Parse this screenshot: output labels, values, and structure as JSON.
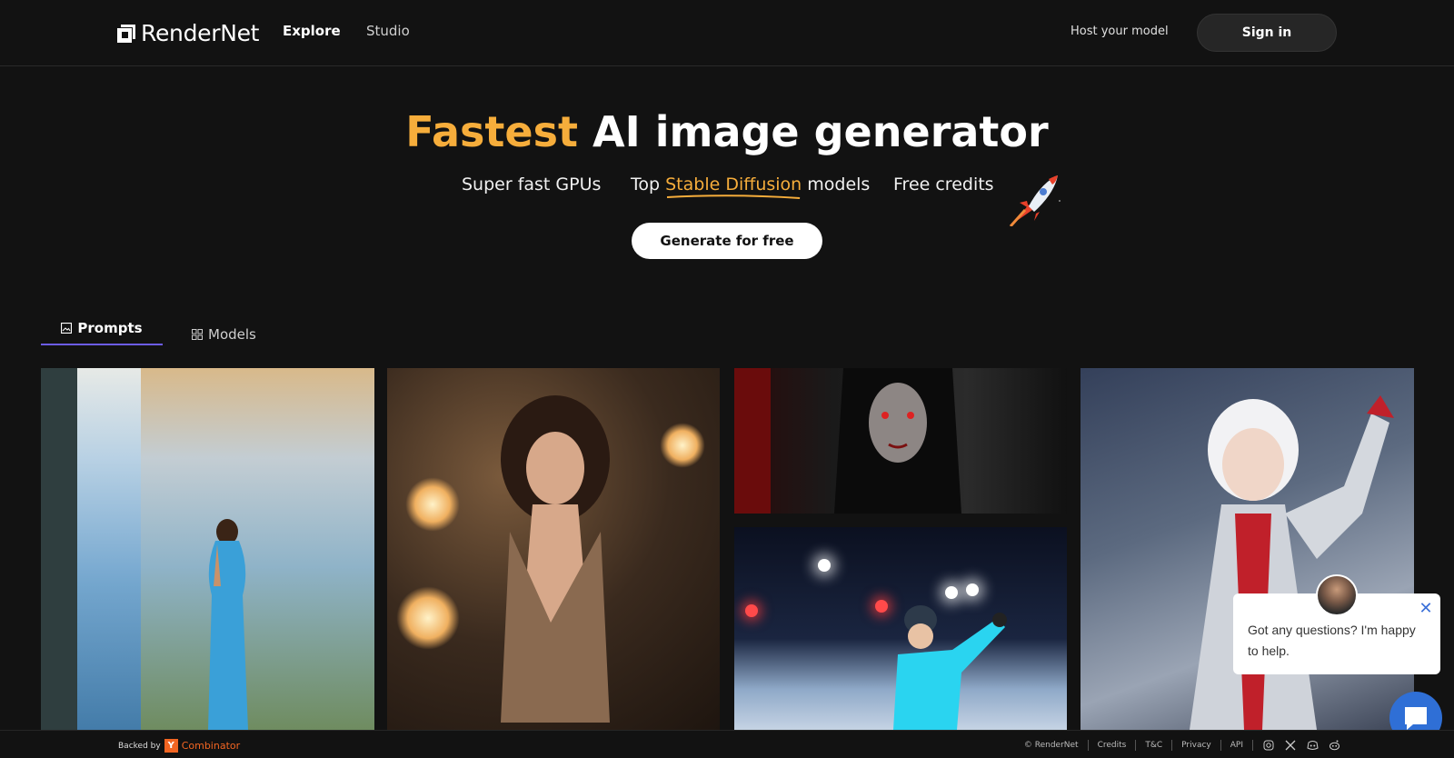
{
  "nav": {
    "logo_text": "RenderNet",
    "links": [
      {
        "label": "Explore",
        "active": true
      },
      {
        "label": "Studio",
        "active": false
      }
    ],
    "host_link": "Host your model",
    "signin": "Sign in"
  },
  "hero": {
    "title_accent": "Fastest",
    "title_rest": "AI image generator",
    "feature_1": "Super fast GPUs",
    "feature_2_prefix": "Top",
    "feature_2_highlight": "Stable Diffusion",
    "feature_2_suffix": "models",
    "feature_3": "Free credits",
    "cta": "Generate for free",
    "accent_color": "#f6ad3b"
  },
  "tabs": [
    {
      "label": "Prompts",
      "icon": "image-icon",
      "active": true
    },
    {
      "label": "Models",
      "icon": "grid-icon",
      "active": false
    }
  ],
  "gallery": [
    {
      "subject": "woman-by-waterfall"
    },
    {
      "subject": "woman-in-restaurant"
    },
    {
      "subject": "vampire-woman"
    },
    {
      "subject": "ice-skater"
    },
    {
      "subject": "silver-robot-girl"
    }
  ],
  "chat": {
    "message": "Got any questions? I'm happy to help.",
    "close_icon": "close-icon"
  },
  "footer": {
    "backed_by": "Backed by",
    "yc_letter": "Y",
    "yc_name": "Combinator",
    "copyright": "© RenderNet",
    "links": [
      "Credits",
      "T&C",
      "Privacy",
      "API"
    ],
    "social": [
      "instagram-icon",
      "x-icon",
      "discord-icon",
      "reddit-icon"
    ]
  }
}
